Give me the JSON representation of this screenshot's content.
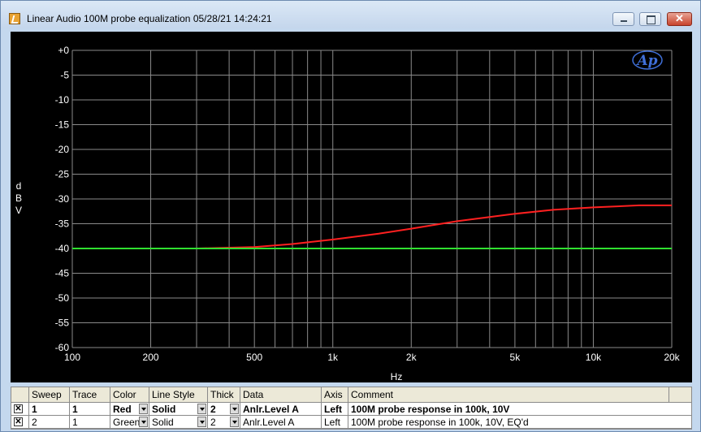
{
  "window": {
    "title": "Linear Audio  100M probe equalization  05/28/21 14:24:21",
    "buttons": {
      "minimize": "minimize",
      "maximize": "maximize",
      "close": "✕"
    }
  },
  "chart_data": {
    "type": "line",
    "xlabel": "Hz",
    "ylabel": "dBV",
    "xscale": "log",
    "xlim": [
      100,
      20000
    ],
    "ylim": [
      -60,
      0
    ],
    "x_ticks": [
      "100",
      "200",
      "500",
      "1k",
      "2k",
      "5k",
      "10k",
      "20k"
    ],
    "y_ticks": [
      "+0",
      "-5",
      "-10",
      "-15",
      "-20",
      "-25",
      "-30",
      "-35",
      "-40",
      "-45",
      "-50",
      "-55",
      "-60"
    ],
    "logo": "Ap",
    "grid": true,
    "series": [
      {
        "color": "#ff2020",
        "x": [
          180,
          300,
          500,
          700,
          1000,
          1500,
          2000,
          3000,
          5000,
          7000,
          10000,
          15000,
          20000
        ],
        "y": [
          -40,
          -40,
          -39.7,
          -39.1,
          -38.2,
          -37,
          -36,
          -34.5,
          -33,
          -32.2,
          -31.7,
          -31.3,
          -31.3
        ]
      },
      {
        "color": "#30e030",
        "x": [
          100,
          200,
          500,
          1000,
          2000,
          5000,
          10000,
          20000
        ],
        "y": [
          -40,
          -40,
          -40,
          -40,
          -40,
          -40,
          -40,
          -40
        ]
      }
    ]
  },
  "table": {
    "headers": [
      "Sweep",
      "Trace",
      "Color",
      "Line Style",
      "Thick",
      "Data",
      "Axis",
      "Comment"
    ],
    "rows": [
      {
        "checked": "✕",
        "sweep": "1",
        "trace": "1",
        "color": "Red",
        "style": "Solid",
        "thick": "2",
        "data": "Anlr.Level A",
        "axis": "Left",
        "comment": "100M probe response in 100k, 10V"
      },
      {
        "checked": "✕",
        "sweep": "2",
        "trace": "1",
        "color": "Green",
        "style": "Solid",
        "thick": "2",
        "data": "Anlr.Level A",
        "axis": "Left",
        "comment": "100M probe response in 100k, 10V, EQ'd"
      }
    ]
  }
}
